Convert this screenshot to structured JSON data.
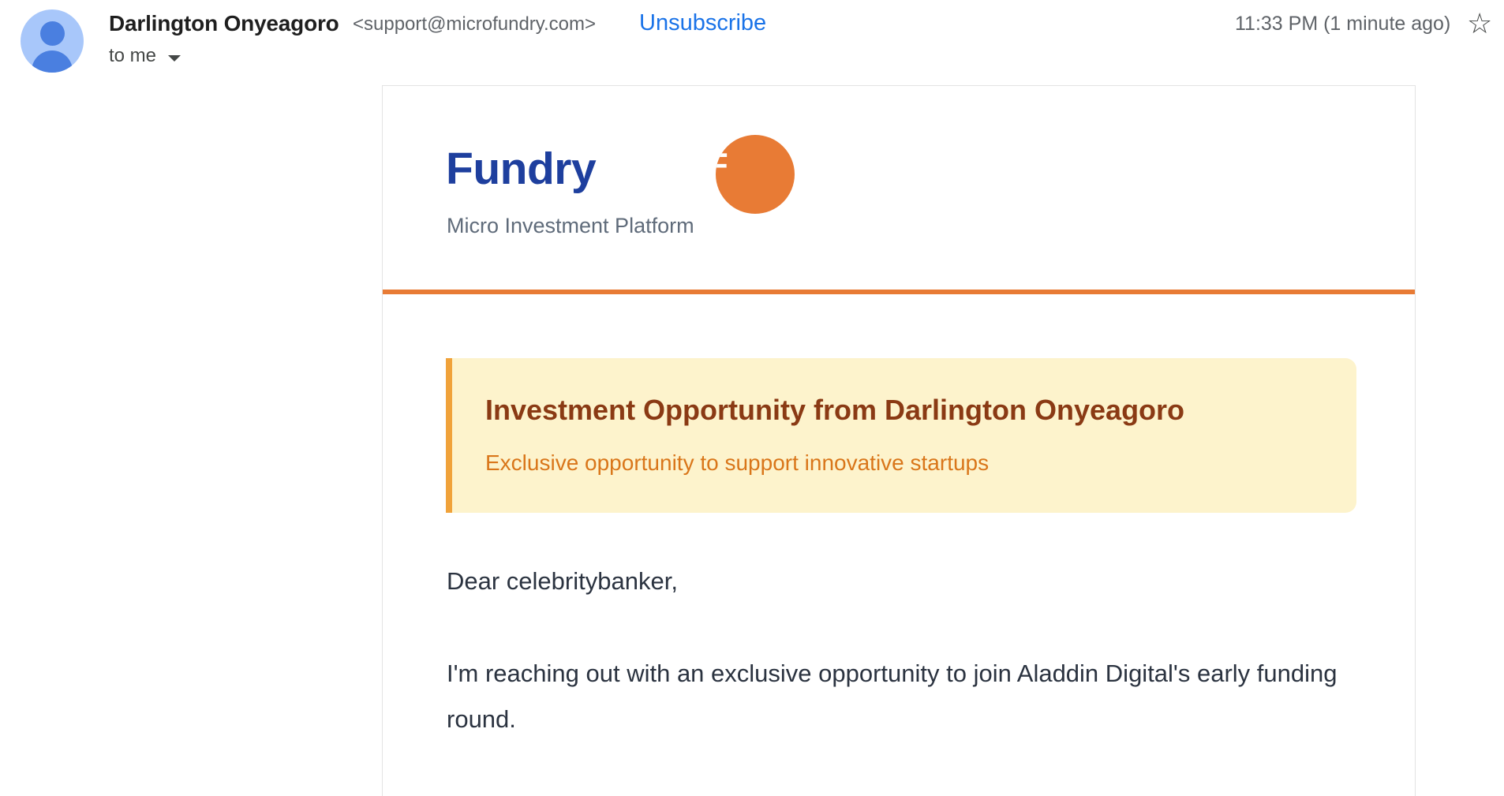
{
  "header": {
    "sender_name": "Darlington Onyeagoro",
    "sender_email": "<support@microfundry.com>",
    "unsubscribe": "Unsubscribe",
    "to": "to me",
    "time": "11:33 PM (1 minute ago)",
    "star_glyph": "☆"
  },
  "email": {
    "brand": "Fundry",
    "tagline": "Micro Investment Platform",
    "logo_letter": "F",
    "callout": {
      "title": "Investment Opportunity from Darlington Onyeagoro",
      "subtitle": "Exclusive opportunity to support innovative startups"
    },
    "greeting": "Dear celebritybanker,",
    "paragraph": "I'm reaching out with an exclusive opportunity to join Aladdin Digital's early funding round."
  },
  "colors": {
    "brand_blue": "#1e3f9e",
    "accent_orange": "#e87b35",
    "callout_bg": "#fdf3cc",
    "callout_border": "#f0a23a",
    "link_blue": "#1a73e8"
  },
  "icons": [
    "avatar-icon",
    "chevron-down-icon",
    "star-icon"
  ]
}
